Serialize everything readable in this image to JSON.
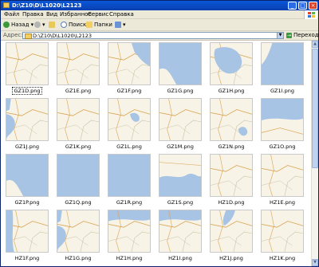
{
  "window": {
    "title": "D:\\Z10\\D\\L1020\\L2123"
  },
  "menu": [
    "Файл",
    "Правка",
    "Вид",
    "Избранное",
    "Сервис",
    "Справка"
  ],
  "toolbar": {
    "back": "Назад",
    "search": "Поиск",
    "folders": "Папки"
  },
  "address": {
    "label": "Адрес:",
    "path": "D:\\Z10\\D\\L1020\\L2123",
    "go": "Переход"
  },
  "files": [
    {
      "name": "GZ1D.png",
      "kind": "land"
    },
    {
      "name": "GZ1E.png",
      "kind": "land"
    },
    {
      "name": "GZ1F.png",
      "kind": "coast-right"
    },
    {
      "name": "GZ1G.png",
      "kind": "water-mostly"
    },
    {
      "name": "GZ1H.png",
      "kind": "lake"
    },
    {
      "name": "GZ1I.png",
      "kind": "water-corner"
    },
    {
      "name": "GZ1J.png",
      "kind": "coast-left"
    },
    {
      "name": "GZ1K.png",
      "kind": "land"
    },
    {
      "name": "GZ1L.png",
      "kind": "lake-small"
    },
    {
      "name": "GZ1M.png",
      "kind": "land"
    },
    {
      "name": "GZ1N.png",
      "kind": "land-lake"
    },
    {
      "name": "GZ1O.png",
      "kind": "water-top"
    },
    {
      "name": "GZ1P.png",
      "kind": "water-mostly"
    },
    {
      "name": "GZ1Q.png",
      "kind": "water"
    },
    {
      "name": "GZ1R.png",
      "kind": "water"
    },
    {
      "name": "GZ1S.png",
      "kind": "coast-bottom"
    },
    {
      "name": "HZ1D.png",
      "kind": "land"
    },
    {
      "name": "HZ1E.png",
      "kind": "land"
    },
    {
      "name": "HZ1F.png",
      "kind": "coast-left-narrow"
    },
    {
      "name": "HZ1G.png",
      "kind": "coast-left"
    },
    {
      "name": "HZ1H.png",
      "kind": "water-top-band"
    },
    {
      "name": "HZ1I.png",
      "kind": "water-top-band"
    },
    {
      "name": "HZ1J.png",
      "kind": "land-inlet"
    },
    {
      "name": "HZ1K.png",
      "kind": "land"
    }
  ]
}
